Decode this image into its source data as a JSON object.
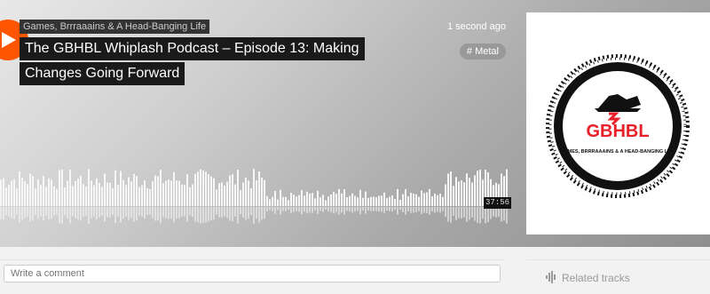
{
  "track": {
    "uploader": "Games, Brrraaains & A Head-Banging Life",
    "title_line1": "The GBHBL Whiplash Podcast – Episode 13: Making",
    "title_line2": "Changes Going Forward",
    "posted": "1 second ago",
    "tag": "# Metal",
    "duration": "37:56",
    "played_fraction": 0
  },
  "artwork": {
    "logo_text": "GBHBL",
    "logo_subtitle": "GAMES, BRRRAAAINS & A HEAD-BANGING LIFE"
  },
  "comment": {
    "placeholder": "Write a comment"
  },
  "sidebar": {
    "related_label": "Related tracks",
    "view_all_label": ""
  },
  "colors": {
    "accent": "#ff5500",
    "logo_red": "#e8202a"
  },
  "icons": {
    "play": "play-icon",
    "related": "waveform-icon"
  }
}
